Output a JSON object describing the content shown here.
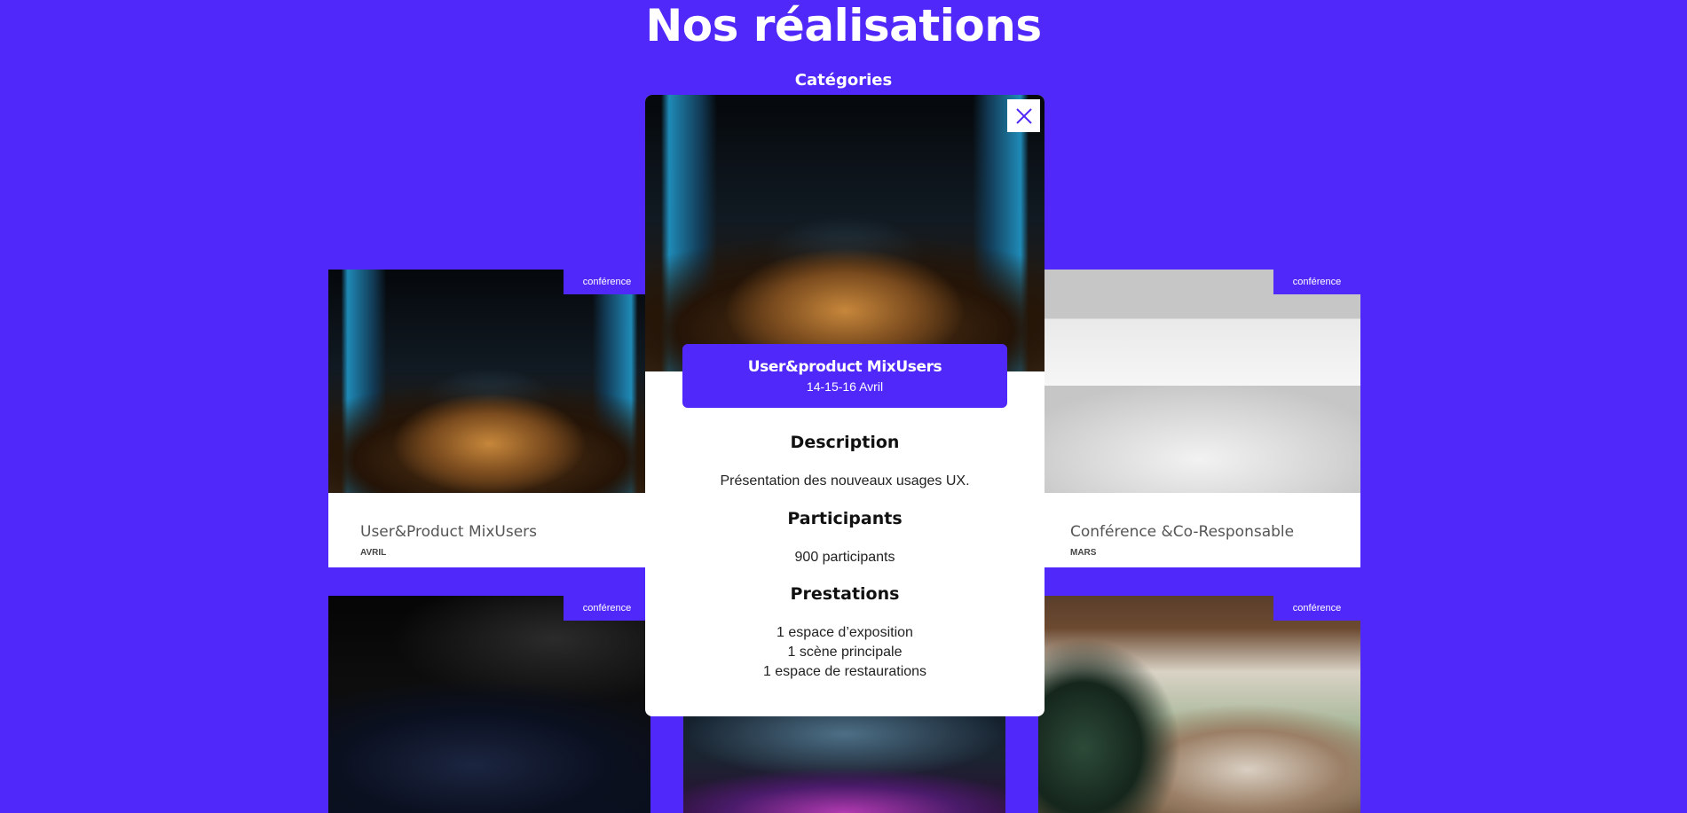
{
  "page": {
    "title": "Nos réalisations",
    "categories_label": "Catégories"
  },
  "colors": {
    "brand": "#5029FA",
    "card_bg": "#FFFFFF",
    "text_dark": "#111111"
  },
  "cards": [
    {
      "badge": "conférence",
      "title": "User&Product MixUsers",
      "month": "AVRIL"
    },
    {
      "badge": "conférence",
      "title": "Conférence &Co-Responsable",
      "month": "MARS"
    },
    {
      "badge": "conférence"
    },
    {
      "badge": "conférence"
    }
  ],
  "modal": {
    "close_icon": "close-icon",
    "title": "User&product MixUsers",
    "dates": "14-15-16 Avril",
    "description_heading": "Description",
    "description": "Présentation des nouveaux usages UX.",
    "participants_heading": "Participants",
    "participants": "900 participants",
    "services_heading": "Prestations",
    "services": [
      "1 espace d’exposition",
      "1 scène principale",
      "1 espace de restaurations"
    ]
  }
}
